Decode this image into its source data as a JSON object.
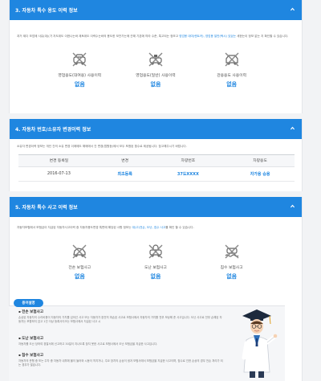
{
  "section3": {
    "title": "3. 자동차 특수 용도 이력 정보",
    "desc_prefix": "과거 제다 모업에 사유(대)(가 자도위도 이한나는바 제토위도 이력수는바의 용도한 모찬가는에 관해 기본에 따라 수준, 특고되는 정보고 ",
    "desc_highlight": "영업용 대여(렌트카), 영업용 일반(택시) 있었는",
    "desc_suffix": " 세한는이 정보 없는 지 확인할 수 있습니다.",
    "items": [
      {
        "icon": "rental-car-icon",
        "label": "영업용도(대여용) 사용이력",
        "value": "없음"
      },
      {
        "icon": "taxi-icon",
        "label": "영업용도(일반) 사용이력",
        "value": "없음"
      },
      {
        "icon": "official-car-icon",
        "label": "관용용도 사용이력",
        "value": "없음"
      }
    ]
  },
  "section4": {
    "title": "4. 자동차 번호/소유자 변경이력 정보",
    "desc": "소유자 변경이력 정보는 개인 간의 소유 변경 이에에도 해에에서 간 변경(법원등)에서 모두 포함된 횟수로 제공됩니다. 참고해주시기 바랍니다.",
    "table_headers": [
      "변경 등록일",
      "변경",
      "차량번호",
      "차량용도"
    ],
    "rows": [
      {
        "date": "2016-07-13",
        "change": "최초등록",
        "number": "37도XXXX",
        "usage": "자가용 승용"
      }
    ]
  },
  "section5": {
    "title": "5. 자동차 특수 사고 이력 정보",
    "desc_prefix": "자동차보험에서 보험금이 지급된 자동차사고이력 중 자동차용도변경 특변에 해당된 사항 정보는 ",
    "desc_highlight": "대(고)전손, 도난, 침수 사고",
    "desc_suffix": "를 확인 할 수 있습니다.",
    "items": [
      {
        "icon": "total-loss-icon",
        "label": "전손 보험사고",
        "value": "없음"
      },
      {
        "icon": "theft-icon",
        "label": "도난 보험사고",
        "value": "없음"
      },
      {
        "icon": "flood-icon",
        "label": "침수 보험사고",
        "value": "없음"
      }
    ],
    "terms_badge": "용어설명",
    "terms": [
      {
        "title": "전손 보험사고",
        "desc": "손상된 자동차의 수리비용이 자동차의 가치를 넘어선 사고 또는 자동차가 완전히 파손된 사고로 보험사에서 자동차의 가치를 전부 보상해 준 사고입니다. 도난 사고로 전부 손해된 자동차는 포함하지 않고 1건 이상 등록사이크는 보험사에서 지급된 사고 시"
      },
      {
        "title": "도난 보험사고",
        "desc": "자동차를 도난 당하여 경찰서에 신고하고 30일이 지나도록 찾지 못한 사고로 보험사에서 도난 보험금을 지급한 사고입니다."
      },
      {
        "title": "침수 보험사고",
        "desc": "자동차의 운행 중 또는 주차 중 자동차 내부에 물이 들어와 시동이 꺼지거나, 주요 장치의 손상이 생겨 보험사에서 보험금을 지급한 사고이며, 침수로 인한 손상의 경우 전손 처리가 되는 경우가 많습니다."
      }
    ]
  },
  "colors": {
    "accent": "#1f86e0"
  }
}
